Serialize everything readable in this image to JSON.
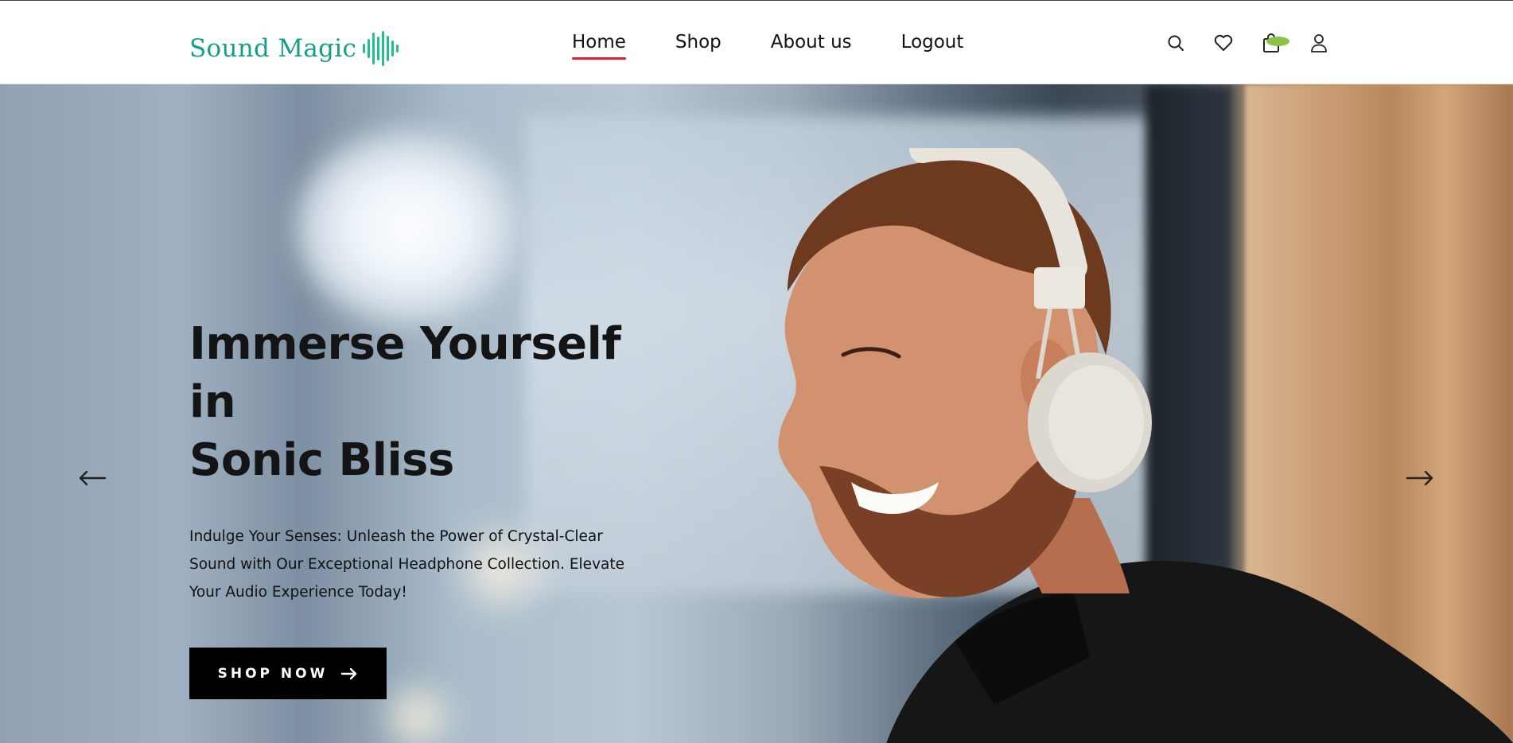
{
  "header": {
    "logo_text": "Sound Magic",
    "logo_color": "#14a085",
    "nav": [
      {
        "label": "Home",
        "active": true
      },
      {
        "label": "Shop",
        "active": false
      },
      {
        "label": "About us",
        "active": false
      },
      {
        "label": "Logout",
        "active": false
      }
    ],
    "active_underline_color": "#e0202c",
    "icons": [
      "search-icon",
      "heart-icon",
      "cart-icon",
      "user-icon"
    ],
    "cart_badge_color": "#8bc34a"
  },
  "hero": {
    "title_line1": "Immerse Yourself in",
    "title_line2": "Sonic Bliss",
    "subtitle": "Indulge Your Senses: Unleash the Power of Crystal-Clear Sound with Our Exceptional Headphone Collection. Elevate Your Audio Experience Today!",
    "cta_label": "SHOP NOW",
    "prev_arrow_icon": "arrow-left-icon",
    "next_arrow_icon": "arrow-right-icon"
  }
}
